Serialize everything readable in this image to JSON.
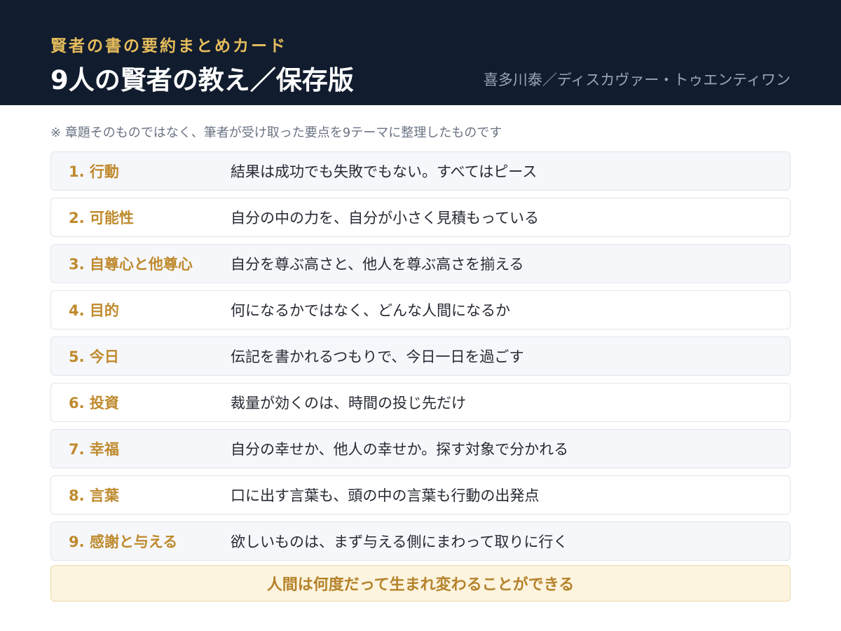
{
  "header": {
    "eyebrow": "賢者の書の要約まとめカード",
    "title": "9人の賢者の教え／保存版",
    "author": "喜多川泰／ディスカヴァー・トゥエンティワン"
  },
  "note": "※ 章題そのものではなく、筆者が受け取った要点を9テーマに整理したものです",
  "items": [
    {
      "label": "1. 行動",
      "text": "結果は成功でも失敗でもない。すべてはピース"
    },
    {
      "label": "2. 可能性",
      "text": "自分の中の力を、自分が小さく見積もっている"
    },
    {
      "label": "3. 自尊心と他尊心",
      "text": "自分を尊ぶ高さと、他人を尊ぶ高さを揃える"
    },
    {
      "label": "4. 目的",
      "text": "何になるかではなく、どんな人間になるか"
    },
    {
      "label": "5. 今日",
      "text": "伝記を書かれるつもりで、今日一日を過ごす"
    },
    {
      "label": "6. 投資",
      "text": "裁量が効くのは、時間の投じ先だけ"
    },
    {
      "label": "7. 幸福",
      "text": "自分の幸せか、他人の幸せか。探す対象で分かれる"
    },
    {
      "label": "8. 言葉",
      "text": "口に出す言葉も、頭の中の言葉も行動の出発点"
    },
    {
      "label": "9. 感謝と与える",
      "text": "欲しいものは、まず与える側にまわって取りに行く"
    }
  ],
  "footer": "人間は何度だって生まれ変わることができる",
  "colors": {
    "header_bg": "#111c2e",
    "accent_gold": "#e6bd5c",
    "label_gold": "#bf8a2d",
    "footer_bg": "#fcf4df"
  }
}
